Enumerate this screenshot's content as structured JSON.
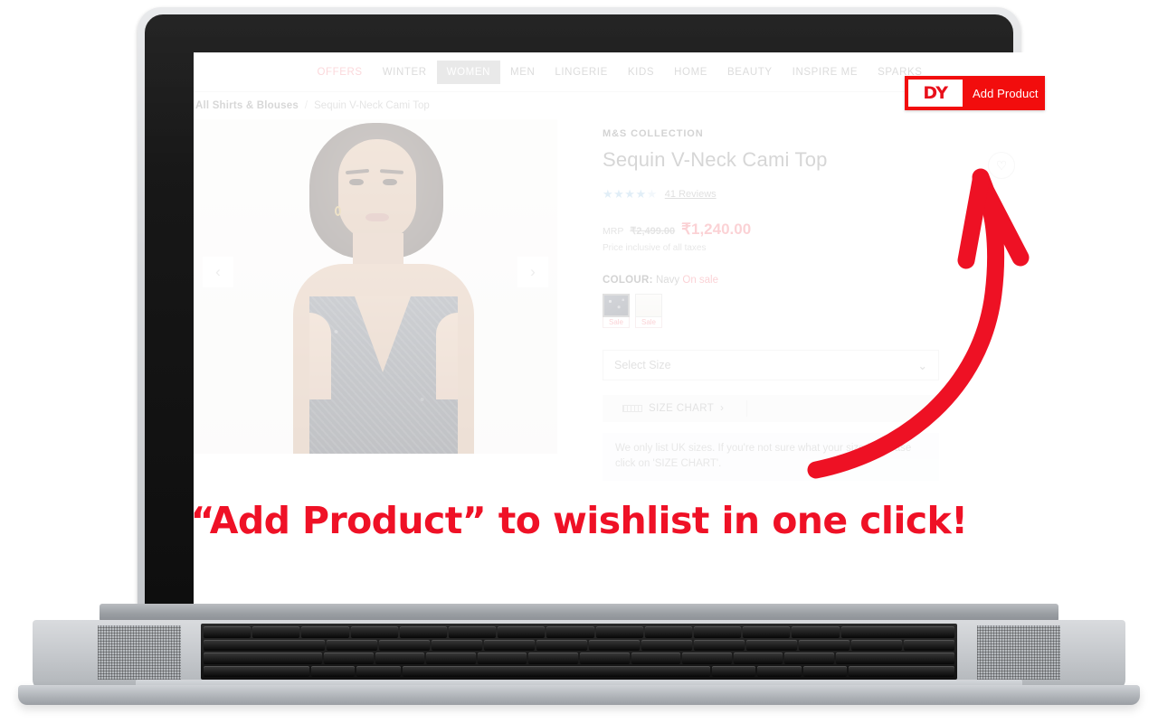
{
  "nav": {
    "items": [
      {
        "label": "OFFERS",
        "style": "offers"
      },
      {
        "label": "WINTER",
        "style": ""
      },
      {
        "label": "WOMEN",
        "style": "active"
      },
      {
        "label": "MEN",
        "style": ""
      },
      {
        "label": "LINGERIE",
        "style": ""
      },
      {
        "label": "KIDS",
        "style": ""
      },
      {
        "label": "HOME",
        "style": ""
      },
      {
        "label": "BEAUTY",
        "style": ""
      },
      {
        "label": "INSPIRE ME",
        "style": ""
      },
      {
        "label": "SPARKS",
        "style": ""
      }
    ]
  },
  "breadcrumb": {
    "parent": "All Shirts & Blouses",
    "separator": "/",
    "current": "Sequin V-Neck Cami Top"
  },
  "gallery": {
    "prev_icon": "‹",
    "next_icon": "›"
  },
  "product": {
    "brand": "M&S COLLECTION",
    "title": "Sequin V-Neck Cami Top",
    "wishlist_icon": "♡",
    "stars_full": "★★★★",
    "stars_half": "★",
    "reviews": "41 Reviews",
    "mrp_label": "MRP",
    "was_price": "₹2,499.00",
    "now_price": "₹1,240.00",
    "tax_note": "Price inclusive of all taxes",
    "colour_label": "COLOUR:",
    "colour_value": "Navy",
    "colour_sale": "On sale",
    "swatches": [
      {
        "name": "Navy",
        "tag": "Sale",
        "selected": true
      },
      {
        "name": "Cream",
        "tag": "Sale",
        "selected": false
      }
    ],
    "size_placeholder": "Select Size",
    "size_chevron": "⌄",
    "size_chart_label": "SIZE CHART",
    "size_chart_chevron": "›",
    "uk_note": "We only list UK sizes. If you're not sure what your size is, please click on 'SIZE CHART'."
  },
  "extension_badge": {
    "logo": "DY",
    "label": "Add Product"
  },
  "caption": {
    "text": "“Add Product” to wishlist in one click!"
  },
  "colors": {
    "brand_red": "#f20d0d",
    "caption_red": "#ef1126",
    "sale_pink": "#f26d78",
    "star_blue": "#9ec8e8"
  }
}
